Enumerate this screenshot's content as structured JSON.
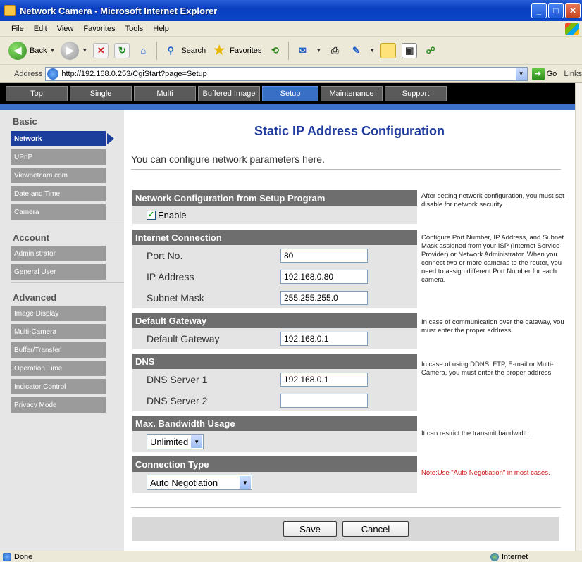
{
  "window": {
    "title": "Network Camera - Microsoft Internet Explorer"
  },
  "menu": [
    "File",
    "Edit",
    "View",
    "Favorites",
    "Tools",
    "Help"
  ],
  "toolbar": {
    "back": "Back",
    "search": "Search",
    "favorites": "Favorites"
  },
  "address": {
    "label": "Address",
    "url": "http://192.168.0.253/CgiStart?page=Setup",
    "go": "Go",
    "links": "Links"
  },
  "nav_tabs": [
    "Top",
    "Single",
    "Multi",
    "Buffered Image",
    "Setup",
    "Maintenance",
    "Support"
  ],
  "sidebar": {
    "basic_heading": "Basic",
    "basic_items": [
      "Network",
      "UPnP",
      "Viewnetcam.com",
      "Date and Time",
      "Camera"
    ],
    "account_heading": "Account",
    "account_items": [
      "Administrator",
      "General User"
    ],
    "advanced_heading": "Advanced",
    "advanced_items": [
      "Image Display",
      "Multi-Camera",
      "Buffer/Transfer",
      "Operation Time",
      "Indicator Control",
      "Privacy Mode"
    ]
  },
  "main": {
    "title": "Static IP Address Configuration",
    "intro": "You can configure network parameters here."
  },
  "form": {
    "setup_program": {
      "heading": "Network Configuration from Setup Program",
      "enable_label": "Enable",
      "enabled": true,
      "note": "After setting network configuration, you must set disable for network security."
    },
    "internet": {
      "heading": "Internet Connection",
      "port_label": "Port No.",
      "port_value": "80",
      "ip_label": "IP Address",
      "ip_value": "192.168.0.80",
      "mask_label": "Subnet Mask",
      "mask_value": "255.255.255.0",
      "note": "Configure Port Number, IP Address, and Subnet Mask assigned from your ISP (Internet Service Provider) or Network Administrator. When you connect two or more cameras to the router, you need to assign different Port Number for each camera."
    },
    "gateway": {
      "heading": "Default Gateway",
      "label": "Default Gateway",
      "value": "192.168.0.1",
      "note": "In case of communication over the gateway, you must enter the proper address."
    },
    "dns": {
      "heading": "DNS",
      "dns1_label": "DNS Server 1",
      "dns1_value": "192.168.0.1",
      "dns2_label": "DNS Server 2",
      "dns2_value": "",
      "note": "In case of using DDNS, FTP, E-mail or Multi-Camera, you must enter the proper address."
    },
    "bandwidth": {
      "heading": "Max. Bandwidth Usage",
      "value": "Unlimited",
      "note": "It can restrict the transmit bandwidth."
    },
    "connection": {
      "heading": "Connection Type",
      "value": "Auto Negotiation",
      "note": "Note:Use \"Auto Negotiation\" in most cases."
    }
  },
  "buttons": {
    "save": "Save",
    "cancel": "Cancel"
  },
  "status": {
    "text": "Done",
    "zone": "Internet"
  },
  "colors": {
    "title_blue": "#1f3a9e",
    "active_nav": "#3a6fc6",
    "active_sidebar": "#1c3f9c",
    "section_header": "#6e6e6e",
    "note_red": "#d01010"
  }
}
